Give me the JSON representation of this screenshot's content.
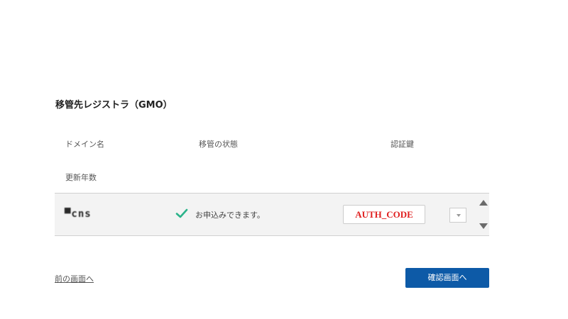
{
  "section": {
    "title": "移管先レジストラ（GMO）"
  },
  "columns": {
    "domain": "ドメイン名",
    "status": "移管の状態",
    "auth_code": "認証鍵",
    "renewal_years": "更新年数"
  },
  "row": {
    "domain_name": "▀cns",
    "status_icon": "check-icon",
    "status_text": "お申込みできます。",
    "auth_code_value": "AUTH_CODE",
    "renewal_years_selected": ""
  },
  "footer": {
    "back_label": "前の画面へ",
    "confirm_label": "確認画面へ"
  },
  "colors": {
    "primary_button": "#0d5aa7",
    "check_green": "#2bb38a",
    "auth_text": "#e02020",
    "row_background": "#f3f3f3"
  }
}
